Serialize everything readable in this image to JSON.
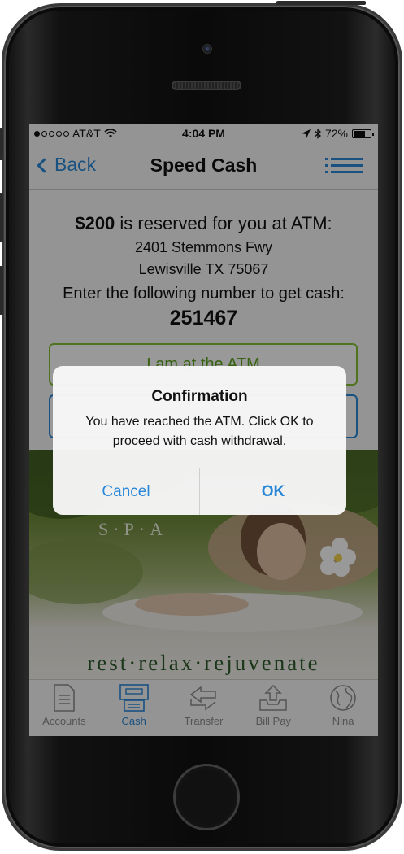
{
  "status_bar": {
    "carrier": "AT&T",
    "time": "4:04 PM",
    "battery": "72%",
    "battery_level": 0.72
  },
  "nav": {
    "back_label": "Back",
    "title": "Speed Cash"
  },
  "reservation": {
    "amount": "$200",
    "reserved_text": " is reserved for you at ATM:",
    "address_line1": "2401 Stemmons Fwy",
    "address_line2": "Lewisville TX 75067",
    "instruction": "Enter the following number to get cash:",
    "code": "251467"
  },
  "buttons": {
    "at_atm_label": "I am at the ATM"
  },
  "ad": {
    "brand": "S·P·A",
    "tagline": "rest·relax·rejuvenate"
  },
  "alert": {
    "title": "Confirmation",
    "message": "You have reached the ATM. Click OK to proceed with cash withdrawal.",
    "cancel_label": "Cancel",
    "ok_label": "OK"
  },
  "tabs": [
    {
      "label": "Accounts",
      "icon": "document-icon"
    },
    {
      "label": "Cash",
      "icon": "atm-icon",
      "active": true
    },
    {
      "label": "Transfer",
      "icon": "transfer-arrows-icon"
    },
    {
      "label": "Bill Pay",
      "icon": "inbox-upload-icon"
    },
    {
      "label": "Nina",
      "icon": "globe-icon"
    }
  ],
  "colors": {
    "accent_blue": "#2a88d8",
    "accent_green": "#86c233",
    "tab_inactive": "#8d8d8d"
  }
}
